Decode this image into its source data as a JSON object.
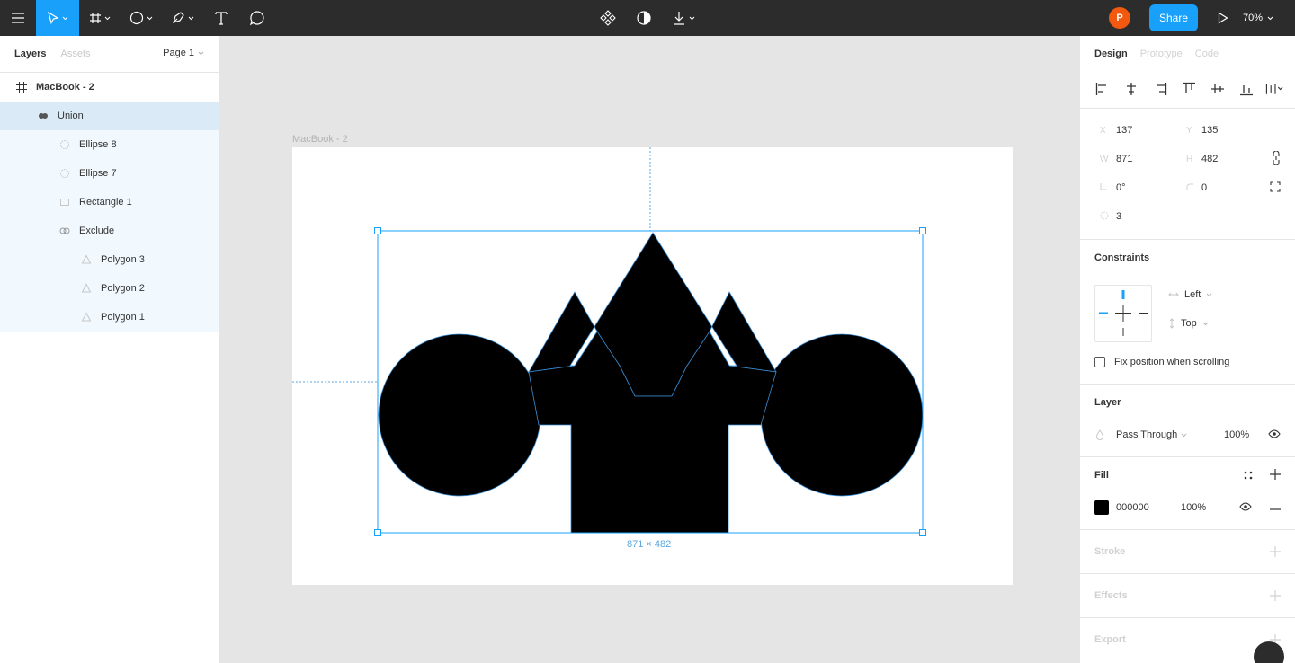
{
  "toolbar": {
    "share_label": "Share",
    "avatar_initial": "P",
    "zoom": "70%"
  },
  "left_panel": {
    "tabs": [
      {
        "label": "Layers"
      },
      {
        "label": "Assets"
      }
    ],
    "page": "Page 1",
    "layers": [
      {
        "name": "MacBook - 2",
        "icon": "frame-icon"
      },
      {
        "name": "Union",
        "icon": "boolean-union-icon"
      },
      {
        "name": "Ellipse 8",
        "icon": "ellipse-icon"
      },
      {
        "name": "Ellipse 7",
        "icon": "ellipse-icon"
      },
      {
        "name": "Rectangle 1",
        "icon": "rectangle-icon"
      },
      {
        "name": "Exclude",
        "icon": "boolean-exclude-icon"
      },
      {
        "name": "Polygon 3",
        "icon": "polygon-icon"
      },
      {
        "name": "Polygon 2",
        "icon": "polygon-icon"
      },
      {
        "name": "Polygon 1",
        "icon": "polygon-icon"
      }
    ]
  },
  "canvas": {
    "frame_label": "MacBook - 2",
    "dimensions": "871 × 482"
  },
  "right_panel": {
    "tabs": [
      {
        "label": "Design"
      },
      {
        "label": "Prototype"
      },
      {
        "label": "Code"
      }
    ],
    "transform": {
      "x_label": "X",
      "x": "137",
      "y_label": "Y",
      "y": "135",
      "w_label": "W",
      "w": "871",
      "h_label": "H",
      "h": "482",
      "rotation": "0°",
      "radius": "0",
      "points": "3"
    },
    "constraints": {
      "title": "Constraints",
      "horizontal": "Left",
      "vertical": "Top",
      "fix_label": "Fix position when scrolling"
    },
    "layer": {
      "title": "Layer",
      "blend": "Pass Through",
      "opacity": "100%"
    },
    "fill": {
      "title": "Fill",
      "hex": "000000",
      "opacity": "100%",
      "color": "#000000"
    },
    "stroke_title": "Stroke",
    "effects_title": "Effects",
    "export_title": "Export"
  },
  "colors": {
    "accent": "#18a0fb",
    "toolbar_bg": "#2c2c2c",
    "avatar": "#f2590f",
    "selection": "#daebf7"
  }
}
